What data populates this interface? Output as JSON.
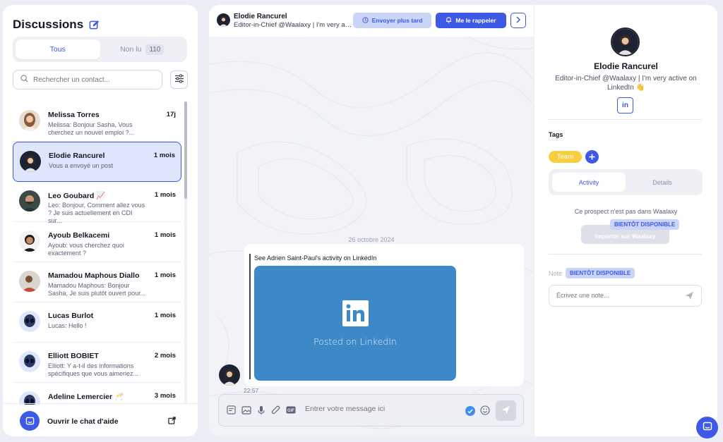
{
  "left": {
    "title": "Discussions",
    "filters": {
      "all": "Tous",
      "unread": "Non lu",
      "unread_count": "110"
    },
    "search_placeholder": "Rechercher un contact...",
    "contacts": [
      {
        "name": "Melissa Torres",
        "time": "17j",
        "preview": "Melissa: Bonjour Sasha, Vous cherchez un nouvel emploi ?...",
        "avatar": "photo-woman"
      },
      {
        "name": "Elodie Rancurel",
        "time": "1 mois",
        "preview": "Vous a envoyé un post",
        "avatar": "photo-woman-2",
        "selected": true
      },
      {
        "name": "Leo Goubard 📈",
        "time": "1 mois",
        "preview": "Leo: Bonjour, Comment allez vous ? Je suis actuellement en CDI sur...",
        "avatar": "photo-man"
      },
      {
        "name": "Ayoub Belkacemi",
        "time": "1 mois",
        "preview": "Ayoub: vous cherchez quoi exactement ?",
        "avatar": "photo-man-2"
      },
      {
        "name": "Mamadou Maphous Diallo",
        "time": "1 mois",
        "preview": "Mamadou Maphous: Bonjour Sasha, Je suis plutôt ouvert pour...",
        "avatar": "photo-man-3"
      },
      {
        "name": "Lucas Burlot",
        "time": "1 mois",
        "preview": "Lucas: Hello !",
        "avatar": "alien-avatar"
      },
      {
        "name": "Elliott BOBIET",
        "time": "2 mois",
        "preview": "Elliott: Y a-t-il des informations spécifiques que vous aimeriez...",
        "avatar": "alien-avatar"
      },
      {
        "name": "Adeline Lemercier 🥂",
        "time": "3 mois",
        "preview": "",
        "avatar": "alien-avatar"
      }
    ],
    "help_label": "Ouvrir le chat d'aide"
  },
  "center": {
    "header": {
      "name": "Elodie Rancurel",
      "subtitle": "Editor-in-Chief @Waalaxy | I'm very acti...",
      "later_button": "Envoyer plus tard",
      "remind_button": "Me le rappeler"
    },
    "date_separator": "26 octobre 2024",
    "message": {
      "text": "See Adrien Saint-Paul's activity on LinkedIn",
      "card_label": "Posted on LinkedIn",
      "time": "22:57"
    },
    "composer_placeholder": "Entrer votre message ici",
    "gif_label": "GIF"
  },
  "right": {
    "name": "Elodie Rancurel",
    "subtitle": "Editor-in-Chief @Waalaxy | I'm very active on LinkedIn 👋",
    "linkedin_label": "in",
    "tags_title": "Tags",
    "tag": "Team",
    "tabs": {
      "activity": "Activity",
      "details": "Details"
    },
    "prospect_note": "Ce prospect n'est pas dans Waalaxy",
    "soon_badge": "BIENTÔT DISPONIBLE",
    "import_button": "Importer sur Waalaxy",
    "note_label": "Note",
    "note_placeholder": "Écrivez une note..."
  },
  "colors": {
    "accent": "#3d59e6",
    "tag": "#f6ce3f",
    "linkedin": "#3d88c7"
  }
}
